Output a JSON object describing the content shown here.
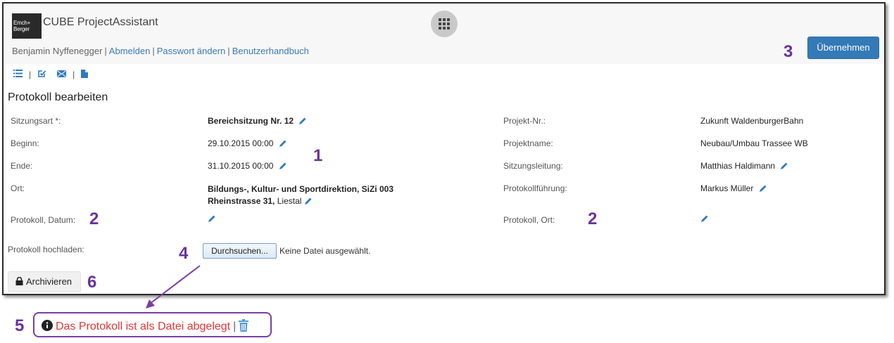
{
  "header": {
    "logo_lines": [
      "Emch+",
      "Berger"
    ],
    "app_title": "CUBE ProjectAssistant",
    "user_name": "Benjamin Nyffenegger",
    "links": [
      "Abmelden",
      "Passwort ändern",
      "Benutzerhandbuch"
    ],
    "apply_button": "Übernehmen"
  },
  "toolbar": {
    "icons": [
      "list-icon",
      "edit-check-icon",
      "mail-icon",
      "document-icon"
    ]
  },
  "form": {
    "title": "Protokoll bearbeiten",
    "left": [
      {
        "label": "Sitzungsart *:",
        "value": "Bereichsitzung Nr. 12"
      },
      {
        "label": "Beginn:",
        "value": "29.10.2015 00:00"
      },
      {
        "label": "Ende:",
        "value": "31.10.2015 00:00"
      },
      {
        "label": "Ort:",
        "value_line1": "Bildungs-, Kultur- und Sportdirektion, SiZi 003",
        "value_line2_bold": "Rheinstrasse 31,",
        "value_line2_rest": "Liestal"
      },
      {
        "label": "Protokoll, Datum:",
        "value": ""
      }
    ],
    "right": [
      {
        "label": "Projekt-Nr.:",
        "value": "Zukunft WaldenburgerBahn"
      },
      {
        "label": "Projektname:",
        "value": "Neubau/Umbau Trassee WB"
      },
      {
        "label": "Sitzungsleitung:",
        "value": "Matthias Haldimann"
      },
      {
        "label": "Protokollführung:",
        "value": "Markus Müller"
      },
      {
        "label": "Protokoll, Ort:",
        "value": ""
      }
    ],
    "upload_label": "Protokoll hochladen:",
    "browse_button": "Durchsuchen...",
    "no_file_text": "Keine Datei ausgewählt.",
    "archive_button": "Archivieren"
  },
  "notice": {
    "text": "Das Protokoll ist als Datei abgelegt",
    "separator": "|"
  },
  "annotations": {
    "n1": "1",
    "n2a": "2",
    "n2b": "2",
    "n3": "3",
    "n4": "4",
    "n5": "5",
    "n6": "6"
  },
  "colors": {
    "primary": "#337ab7",
    "link": "#3b7bb5",
    "annotation": "#6a329f",
    "notice_text": "#e53535"
  }
}
